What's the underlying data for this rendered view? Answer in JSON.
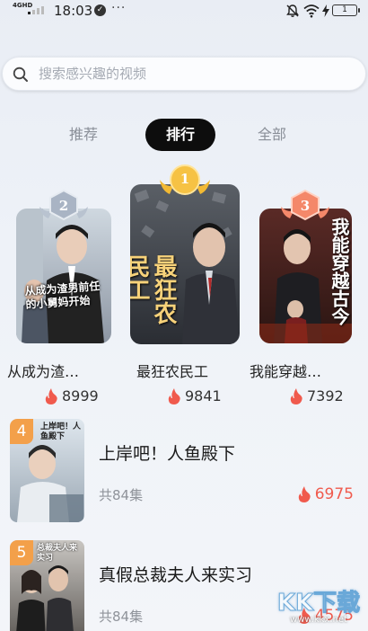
{
  "status_bar": {
    "network": "4GHD",
    "time": "18:03",
    "badge": "✓",
    "more": "···",
    "battery": "1"
  },
  "search": {
    "placeholder": "搜索感兴趣的视频"
  },
  "tabs": [
    {
      "label": "推荐",
      "active": false
    },
    {
      "label": "排行",
      "active": true
    },
    {
      "label": "全部",
      "active": false
    }
  ],
  "top_three": [
    {
      "rank": "2",
      "title": "从成为渣…",
      "hot": "8999",
      "poster_text": "从成为渣男前任的小舅妈开始",
      "medal_color": "#a9b4c4"
    },
    {
      "rank": "1",
      "title": "最狂农民工",
      "hot": "9841",
      "poster_text": "最狂农民工",
      "medal_color": "#f2b933"
    },
    {
      "rank": "3",
      "title": "我能穿越…",
      "hot": "7392",
      "poster_text": "我能穿越古今",
      "medal_color": "#f4886a"
    }
  ],
  "list": [
    {
      "rank": "4",
      "title": "上岸吧！人鱼殿下",
      "episodes": "共84集",
      "hot": "6975",
      "badge_color": "#f3a04a",
      "poster_text": "上岸吧！人鱼殿下"
    },
    {
      "rank": "5",
      "title": "真假总裁夫人来实习",
      "episodes": "共84集",
      "hot": "4575",
      "badge_color": "#f3a04a",
      "poster_text": "总裁夫人来实习"
    }
  ],
  "watermark": {
    "text": "KK下载",
    "site": "www.kkx.net"
  },
  "colors": {
    "accent": "#f05a4d",
    "active_tab": "#0d0d0d"
  }
}
